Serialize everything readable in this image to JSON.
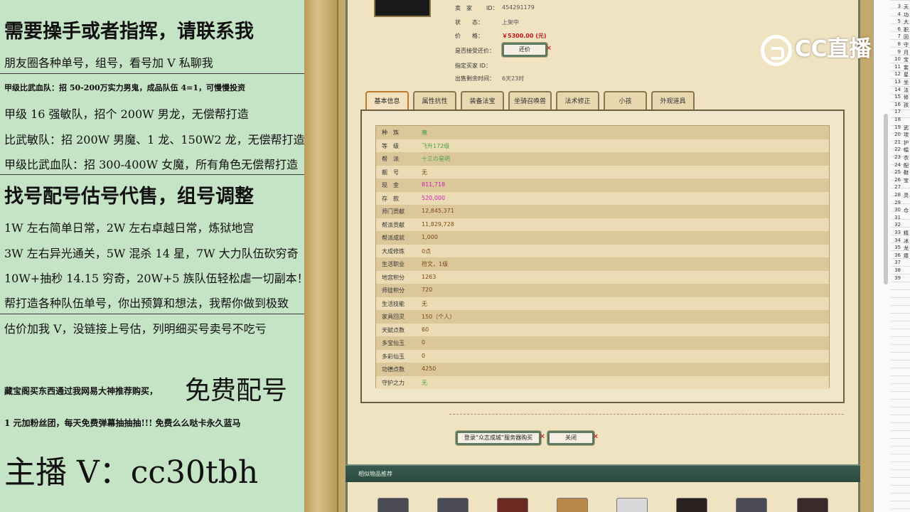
{
  "ad_panel": {
    "lines": [
      "需要操手或者指挥，请联系我",
      "朋友圈各种单号，组号，看号加 V 私聊我",
      "甲级比武血队：招 50-200万实力男鬼，成品队伍 4=1，可慢慢投资",
      "甲级 16 强敏队，招个 200W 男龙，无偿帮打造",
      "比武敏队：招 200W 男魔、1 龙、150W2 龙，无偿帮打造",
      "甲级比武血队：招 300-400W 女魔，所有角色无偿帮打造",
      "找号配号估号代售，组号调整",
      "1W 左右简单日常，2W 左右卓越日常，炼狱地宫",
      "3W 左右异光通关，5W 混杀 14 星，7W 大力队伍砍穷奇",
      "10W+抽秒 14.15 穷奇，20W+5 族队伍轻松虐一切副本！",
      "帮打造各种队伍单号，你出预算和想法，我帮你做到极致",
      "估价加我 V，没链接上号估，列明细买号卖号不吃亏",
      "藏宝阁买东西通过我网易大神推荐购买，",
      "免费配号",
      "1 元加粉丝团，每天免费弹幕抽抽抽!!! 免费么么哒卡永久蓝马",
      "主播 V：cc30tbh"
    ]
  },
  "seller_info": {
    "seller_label": "卖　家",
    "id_label": "ID：",
    "id_value": "454291179",
    "status_label": "状　　态：",
    "status_value": "上架中",
    "price_label": "价　　格：",
    "price_value": "￥5300.00 (元)",
    "bargain_label": "是否接受还价：",
    "bargain_button": "还价",
    "buyer_id_label": "指定买家 ID：",
    "remaining_label": "出售剩余时间：",
    "remaining_value": "6天23时"
  },
  "tabs": [
    "基本信息",
    "属性抗性",
    "装备法宝",
    "坐骑召唤兽",
    "法术修正",
    "小孩",
    "外观道具"
  ],
  "basic_info": [
    {
      "k": "种　族",
      "v": "魔",
      "color": "green"
    },
    {
      "k": "等　级",
      "v": "飞升172级",
      "color": "green"
    },
    {
      "k": "帮　派",
      "v": "十三の星明",
      "color": "green"
    },
    {
      "k": "靓　号",
      "v": "无",
      "color": "brown"
    },
    {
      "k": "现　金",
      "v": "811,718",
      "color": "magenta"
    },
    {
      "k": "存　款",
      "v": "520,000",
      "color": "magenta"
    },
    {
      "k": "师门贡献",
      "v": "12,845,371",
      "color": "brown"
    },
    {
      "k": "帮派贡献",
      "v": "11,829,728",
      "color": "brown"
    },
    {
      "k": "帮派成就",
      "v": "1,000",
      "color": "brown"
    },
    {
      "k": "大成修炼",
      "v": "0点",
      "color": "brown"
    },
    {
      "k": "生活职业",
      "v": "符文，1级",
      "color": "brown"
    },
    {
      "k": "地宫积分",
      "v": "1263",
      "color": "brown"
    },
    {
      "k": "师徒积分",
      "v": "720",
      "color": "brown"
    },
    {
      "k": "生活技能",
      "v": "无",
      "color": "brown"
    },
    {
      "k": "家具回灵",
      "v": "150（个人）",
      "color": "brown"
    },
    {
      "k": "天赋点数",
      "v": "60",
      "color": "brown"
    },
    {
      "k": "多宝仙玉",
      "v": "0",
      "color": "brown"
    },
    {
      "k": "多彩仙玉",
      "v": "0",
      "color": "brown"
    },
    {
      "k": "功德点数",
      "v": "4250",
      "color": "brown"
    },
    {
      "k": "守护之力",
      "v": "无",
      "color": "green"
    }
  ],
  "bottom_buttons": {
    "login_buy": "登录“众志成城”服务器购买",
    "close": "关闭"
  },
  "recommend_header": "相似物品推荐",
  "logo_text": "CC直播",
  "right_edge": {
    "numbers": [
      "3",
      "4",
      "5",
      "6",
      "7",
      "8",
      "9",
      "10",
      "11",
      "12",
      "13",
      "14",
      "15",
      "16",
      "17",
      "18",
      "19",
      "20",
      "21",
      "22",
      "23",
      "24",
      "25",
      "26",
      "27",
      "28",
      "29",
      "30",
      "31",
      "32",
      "33",
      "34",
      "35",
      "36",
      "37",
      "38",
      "39"
    ],
    "chars": [
      "天",
      "功",
      "大",
      "职",
      "回",
      "守",
      "月",
      "宝",
      "套",
      "星",
      "坐",
      "法",
      "修",
      "孩",
      "",
      "",
      "武",
      "项",
      "护",
      "幅",
      "衣",
      "配",
      "鞋",
      "宝",
      "",
      "灵",
      "",
      "仓",
      "",
      "",
      "精",
      "冰",
      "龙",
      "瘴",
      "",
      "",
      ""
    ]
  },
  "colors": {
    "ad_bg": "#c5e3c5",
    "frame_border": "#6c7a66",
    "price_red": "#c0151a",
    "value_green": "#4aa34a",
    "value_magenta": "#d01fb5"
  }
}
